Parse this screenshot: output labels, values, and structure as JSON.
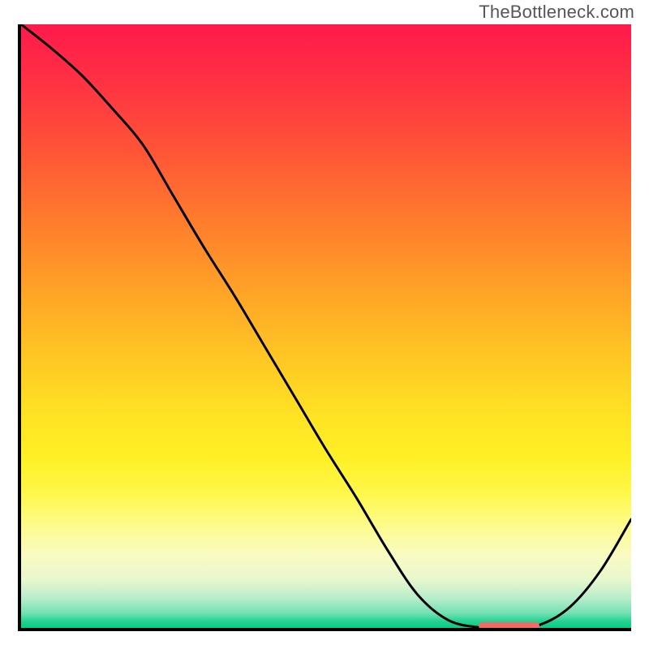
{
  "attribution": "TheBottleneck.com",
  "colors": {
    "axis": "#000000",
    "curve": "#000000",
    "marker": "#f26a63",
    "gradient_top": "#ff1a4b",
    "gradient_bottom": "#07cd85"
  },
  "chart_data": {
    "type": "line",
    "title": "",
    "xlabel": "",
    "ylabel": "",
    "xlim": [
      0,
      100
    ],
    "ylim": [
      0,
      100
    ],
    "grid": false,
    "legend": false,
    "x": [
      0,
      5,
      10,
      15,
      20,
      25,
      30,
      35,
      40,
      45,
      50,
      55,
      60,
      65,
      70,
      75,
      80,
      85,
      90,
      95,
      100
    ],
    "values": [
      100,
      96,
      91.5,
      86,
      80,
      71.5,
      63,
      55,
      46.5,
      38,
      29.5,
      21.5,
      13,
      5.5,
      1.3,
      0.1,
      0,
      0.5,
      3.5,
      9.5,
      18
    ],
    "optimal_range": {
      "x_start": 75,
      "x_end": 85,
      "y": 0.3
    },
    "notes": "Background color maps vertical position from red (high mismatch) at top to green (optimal) at bottom; black curve shows mismatch vs. parameter; red marker near baseline indicates optimal region."
  }
}
